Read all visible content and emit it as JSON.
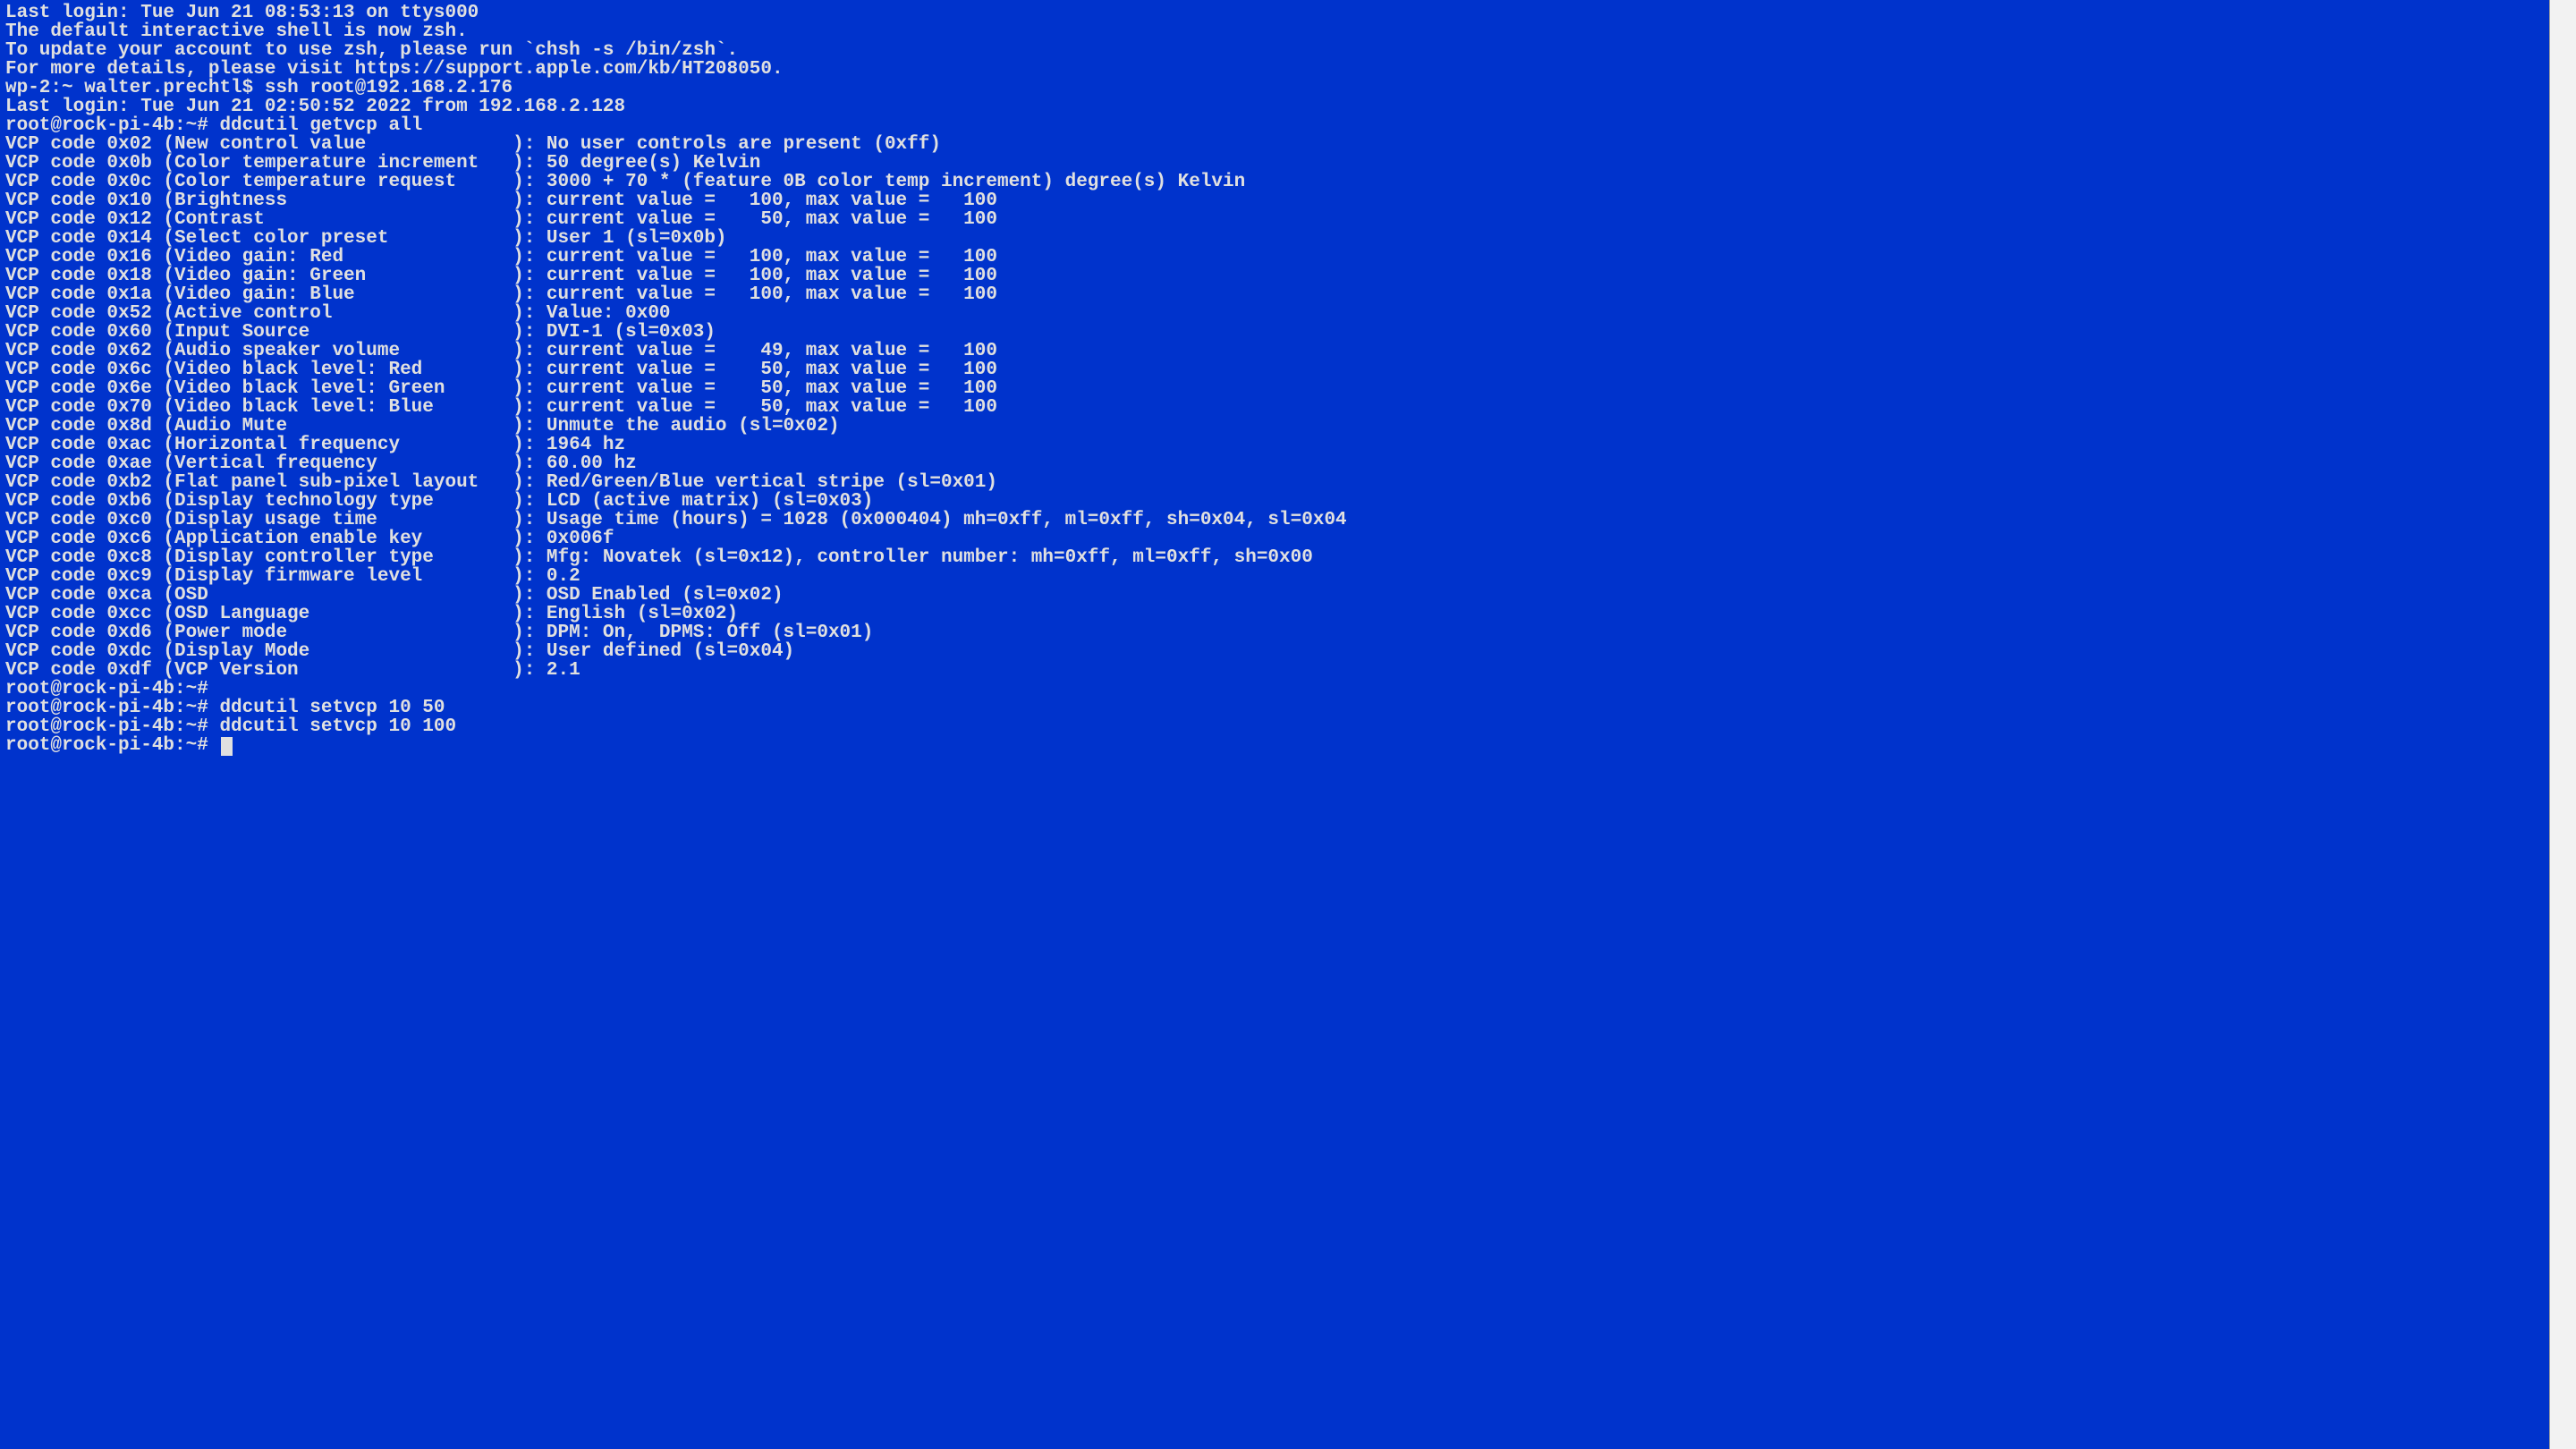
{
  "colors": {
    "bg": "#0033cc",
    "fg": "#e0e0e0"
  },
  "terminal": {
    "last_login_local": "Last login: Tue Jun 21 08:53:13 on ttys000",
    "blank1": "",
    "zsh_notice_1": "The default interactive shell is now zsh.",
    "zsh_notice_2": "To update your account to use zsh, please run `chsh -s /bin/zsh`.",
    "zsh_notice_3": "For more details, please visit https://support.apple.com/kb/HT208050.",
    "prompt_local": "wp-2:~ walter.prechtl$ ",
    "ssh_cmd": "ssh root@192.168.2.176",
    "last_login_remote": "Last login: Tue Jun 21 02:50:52 2022 from 192.168.2.128",
    "prompt_remote": "root@rock-pi-4b:~# ",
    "cmd_getvcp": "ddcutil getvcp all",
    "vcp_lines": [
      "VCP code 0x02 (New control value             ): No user controls are present (0xff)",
      "VCP code 0x0b (Color temperature increment   ): 50 degree(s) Kelvin",
      "VCP code 0x0c (Color temperature request     ): 3000 + 70 * (feature 0B color temp increment) degree(s) Kelvin",
      "VCP code 0x10 (Brightness                    ): current value =   100, max value =   100",
      "VCP code 0x12 (Contrast                      ): current value =    50, max value =   100",
      "VCP code 0x14 (Select color preset           ): User 1 (sl=0x0b)",
      "VCP code 0x16 (Video gain: Red               ): current value =   100, max value =   100",
      "VCP code 0x18 (Video gain: Green             ): current value =   100, max value =   100",
      "VCP code 0x1a (Video gain: Blue              ): current value =   100, max value =   100",
      "VCP code 0x52 (Active control                ): Value: 0x00",
      "VCP code 0x60 (Input Source                  ): DVI-1 (sl=0x03)",
      "VCP code 0x62 (Audio speaker volume          ): current value =    49, max value =   100",
      "VCP code 0x6c (Video black level: Red        ): current value =    50, max value =   100",
      "VCP code 0x6e (Video black level: Green      ): current value =    50, max value =   100",
      "VCP code 0x70 (Video black level: Blue       ): current value =    50, max value =   100",
      "VCP code 0x8d (Audio Mute                    ): Unmute the audio (sl=0x02)",
      "VCP code 0xac (Horizontal frequency          ): 1964 hz",
      "VCP code 0xae (Vertical frequency            ): 60.00 hz",
      "VCP code 0xb2 (Flat panel sub-pixel layout   ): Red/Green/Blue vertical stripe (sl=0x01)",
      "VCP code 0xb6 (Display technology type       ): LCD (active matrix) (sl=0x03)",
      "VCP code 0xc0 (Display usage time            ): Usage time (hours) = 1028 (0x000404) mh=0xff, ml=0xff, sh=0x04, sl=0x04",
      "VCP code 0xc6 (Application enable key        ): 0x006f",
      "VCP code 0xc8 (Display controller type       ): Mfg: Novatek (sl=0x12), controller number: mh=0xff, ml=0xff, sh=0x00",
      "VCP code 0xc9 (Display firmware level        ): 0.2",
      "VCP code 0xca (OSD                           ): OSD Enabled (sl=0x02)",
      "VCP code 0xcc (OSD Language                  ): English (sl=0x02)",
      "VCP code 0xd6 (Power mode                    ): DPM: On,  DPMS: Off (sl=0x01)",
      "VCP code 0xdc (Display Mode                  ): User defined (sl=0x04)",
      "VCP code 0xdf (VCP Version                   ): 2.1"
    ],
    "cmd_empty": "",
    "cmd_setvcp_50": "ddcutil setvcp 10 50",
    "cmd_setvcp_100": "ddcutil setvcp 10 100"
  }
}
